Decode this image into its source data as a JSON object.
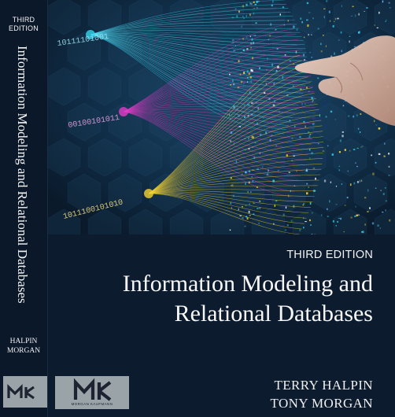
{
  "spine": {
    "edition_line1": "THIRD",
    "edition_line2": "EDITION",
    "title": "Information Modeling and Relational Databases",
    "author1": "HALPIN",
    "author2": "MORGAN"
  },
  "front": {
    "edition": "THIRD EDITION",
    "title_line1": "Information Modeling and",
    "title_line2": "Relational Databases",
    "author1": "TERRY HALPIN",
    "author2": "TONY MORGAN"
  },
  "publisher": {
    "monogram": "MK",
    "name": "MORGAN KAUFMANN"
  },
  "art": {
    "binary_strings": [
      "10111101001",
      "00100101011",
      "1011100101010"
    ],
    "colors": {
      "cyan": "#36d4ee",
      "magenta": "#e23cc8",
      "yellow": "#f3d232",
      "background": "#0d2035"
    }
  }
}
